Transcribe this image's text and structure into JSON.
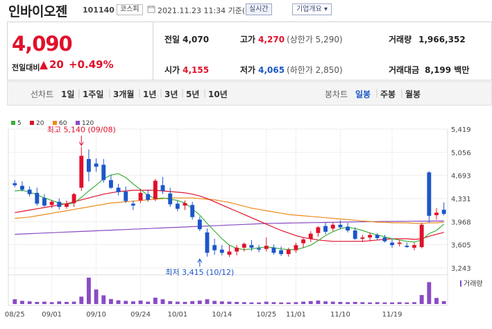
{
  "header": {
    "name": "인바이오젠",
    "code": "101140",
    "market": "코스피",
    "datetime": "2021.11.23 11:34 기준(장중)",
    "realtime_button": "실시간",
    "company_button": "기업개요 ▾"
  },
  "quote": {
    "price": "4,090",
    "diff_label": "전일대비",
    "diff_value": "20",
    "diff_rate": "+0.49%",
    "prev_close_label": "전일",
    "prev_close": "4,070",
    "high_label": "고가",
    "high": "4,270",
    "upper_limit": "(상한가 5,290)",
    "volume_label": "거래량",
    "volume": "1,966,352",
    "open_label": "시가",
    "open": "4,155",
    "low_label": "저가",
    "low": "4,065",
    "lower_limit": "(하한가 2,850)",
    "amount_label": "거래대금",
    "amount": "8,199 백만"
  },
  "tabs": {
    "line_label": "선차트",
    "line_periods": [
      "1일",
      "1주일",
      "3개월",
      "1년",
      "3년",
      "5년",
      "10년"
    ],
    "candle_label": "봉차트",
    "candle_periods": [
      "일봉",
      "주봉",
      "월봉"
    ],
    "active_candle": "일봉"
  },
  "colors": {
    "up": "#e0112b",
    "down": "#1c56c9",
    "ma5": "#3bb03b",
    "ma20": "#e0112b",
    "ma60": "#ef8a1a",
    "ma120": "#8a4bc4",
    "volume": "#8a4bc4"
  },
  "chart_data": {
    "type": "candlestick",
    "legend": [
      "5",
      "20",
      "60",
      "120"
    ],
    "y_ticks": [
      "5,419",
      "5,056",
      "4,693",
      "4,331",
      "3,968",
      "3,605",
      "3,243"
    ],
    "ylim": [
      3243,
      5419
    ],
    "x_labels": [
      "08/25",
      "09/01",
      "09/10",
      "09/24",
      "10/01",
      "10/14",
      "10/25",
      "11/01",
      "11/10",
      "11/19"
    ],
    "x_label_index": [
      0,
      5,
      11,
      17,
      22,
      28,
      34,
      38,
      44,
      51
    ],
    "high_annotation": "최고 5,140 (09/08)",
    "high_index": 9,
    "high_value": 5140,
    "low_annotation": "최저 3,415 (10/12)",
    "low_index": 25,
    "low_value": 3415,
    "volume_label": "거래량",
    "candles": [
      {
        "o": 4570,
        "h": 4620,
        "l": 4510,
        "c": 4540
      },
      {
        "o": 4530,
        "h": 4600,
        "l": 4440,
        "c": 4470
      },
      {
        "o": 4470,
        "h": 4520,
        "l": 4360,
        "c": 4400
      },
      {
        "o": 4420,
        "h": 4500,
        "l": 4220,
        "c": 4250
      },
      {
        "o": 4340,
        "h": 4400,
        "l": 4200,
        "c": 4220
      },
      {
        "o": 4230,
        "h": 4310,
        "l": 4180,
        "c": 4280
      },
      {
        "o": 4280,
        "h": 4330,
        "l": 4160,
        "c": 4200
      },
      {
        "o": 4200,
        "h": 4300,
        "l": 4170,
        "c": 4250
      },
      {
        "o": 4260,
        "h": 4420,
        "l": 4200,
        "c": 4400
      },
      {
        "o": 4500,
        "h": 5140,
        "l": 4450,
        "c": 5000
      },
      {
        "o": 4950,
        "h": 5100,
        "l": 4600,
        "c": 4750
      },
      {
        "o": 4880,
        "h": 4960,
        "l": 4750,
        "c": 4830
      },
      {
        "o": 4860,
        "h": 4950,
        "l": 4580,
        "c": 4620
      },
      {
        "o": 4620,
        "h": 4700,
        "l": 4480,
        "c": 4500
      },
      {
        "o": 4500,
        "h": 4560,
        "l": 4380,
        "c": 4430
      },
      {
        "o": 4440,
        "h": 4520,
        "l": 4260,
        "c": 4290
      },
      {
        "o": 4250,
        "h": 4300,
        "l": 4150,
        "c": 4220
      },
      {
        "o": 4300,
        "h": 4480,
        "l": 4260,
        "c": 4420
      },
      {
        "o": 4400,
        "h": 4470,
        "l": 4280,
        "c": 4310
      },
      {
        "o": 4320,
        "h": 4640,
        "l": 4290,
        "c": 4610
      },
      {
        "o": 4540,
        "h": 4670,
        "l": 4400,
        "c": 4450
      },
      {
        "o": 4410,
        "h": 4500,
        "l": 4200,
        "c": 4240
      },
      {
        "o": 4250,
        "h": 4300,
        "l": 4130,
        "c": 4170
      },
      {
        "o": 4220,
        "h": 4300,
        "l": 4150,
        "c": 4260
      },
      {
        "o": 4230,
        "h": 4280,
        "l": 4000,
        "c": 4040
      },
      {
        "o": 4000,
        "h": 4050,
        "l": 3820,
        "c": 3850
      },
      {
        "o": 3800,
        "h": 3860,
        "l": 3420,
        "c": 3480
      },
      {
        "o": 3600,
        "h": 3700,
        "l": 3450,
        "c": 3520
      },
      {
        "o": 3530,
        "h": 3600,
        "l": 3440,
        "c": 3480
      },
      {
        "o": 3450,
        "h": 3600,
        "l": 3415,
        "c": 3500
      },
      {
        "o": 3500,
        "h": 3600,
        "l": 3440,
        "c": 3560
      },
      {
        "o": 3560,
        "h": 3640,
        "l": 3500,
        "c": 3620
      },
      {
        "o": 3600,
        "h": 3680,
        "l": 3510,
        "c": 3560
      },
      {
        "o": 3550,
        "h": 3600,
        "l": 3490,
        "c": 3530
      },
      {
        "o": 3540,
        "h": 3720,
        "l": 3500,
        "c": 3590
      },
      {
        "o": 3560,
        "h": 3610,
        "l": 3450,
        "c": 3480
      },
      {
        "o": 3520,
        "h": 3580,
        "l": 3430,
        "c": 3460
      },
      {
        "o": 3460,
        "h": 3560,
        "l": 3420,
        "c": 3530
      },
      {
        "o": 3520,
        "h": 3640,
        "l": 3480,
        "c": 3600
      },
      {
        "o": 3630,
        "h": 3720,
        "l": 3560,
        "c": 3690
      },
      {
        "o": 3700,
        "h": 3820,
        "l": 3650,
        "c": 3780
      },
      {
        "o": 3790,
        "h": 3900,
        "l": 3730,
        "c": 3880
      },
      {
        "o": 3900,
        "h": 3950,
        "l": 3770,
        "c": 3810
      },
      {
        "o": 3860,
        "h": 3960,
        "l": 3820,
        "c": 3920
      },
      {
        "o": 3920,
        "h": 3990,
        "l": 3850,
        "c": 3880
      },
      {
        "o": 3890,
        "h": 3950,
        "l": 3800,
        "c": 3830
      },
      {
        "o": 3830,
        "h": 3880,
        "l": 3680,
        "c": 3700
      },
      {
        "o": 3700,
        "h": 3760,
        "l": 3650,
        "c": 3720
      },
      {
        "o": 3720,
        "h": 3800,
        "l": 3660,
        "c": 3760
      },
      {
        "o": 3760,
        "h": 3790,
        "l": 3680,
        "c": 3710
      },
      {
        "o": 3720,
        "h": 3760,
        "l": 3640,
        "c": 3660
      },
      {
        "o": 3640,
        "h": 3700,
        "l": 3560,
        "c": 3600
      },
      {
        "o": 3620,
        "h": 3680,
        "l": 3580,
        "c": 3640
      },
      {
        "o": 3590,
        "h": 3640,
        "l": 3560,
        "c": 3570
      },
      {
        "o": 3560,
        "h": 3640,
        "l": 3520,
        "c": 3600
      },
      {
        "o": 3570,
        "h": 3950,
        "l": 3550,
        "c": 3920
      },
      {
        "o": 4740,
        "h": 4760,
        "l": 3950,
        "c": 4060
      },
      {
        "o": 4070,
        "h": 4180,
        "l": 4000,
        "c": 4110
      },
      {
        "o": 4155,
        "h": 4270,
        "l": 4065,
        "c": 4090
      }
    ],
    "volumes": [
      0.18,
      0.12,
      0.1,
      0.08,
      0.09,
      0.07,
      0.1,
      0.08,
      0.09,
      0.28,
      1.0,
      0.55,
      0.33,
      0.19,
      0.14,
      0.12,
      0.1,
      0.13,
      0.09,
      0.24,
      0.18,
      0.11,
      0.09,
      0.08,
      0.11,
      0.13,
      0.18,
      0.12,
      0.1,
      0.09,
      0.08,
      0.07,
      0.06,
      0.06,
      0.09,
      0.07,
      0.06,
      0.06,
      0.07,
      0.09,
      0.11,
      0.13,
      0.1,
      0.09,
      0.08,
      0.07,
      0.08,
      0.07,
      0.06,
      0.07,
      0.06,
      0.06,
      0.07,
      0.06,
      0.07,
      0.34,
      0.83,
      0.23,
      0.11
    ],
    "ma5": [
      4450,
      4460,
      4430,
      4390,
      4340,
      4300,
      4260,
      4240,
      4260,
      4350,
      4450,
      4540,
      4640,
      4700,
      4720,
      4660,
      4560,
      4470,
      4380,
      4330,
      4340,
      4320,
      4300,
      4260,
      4170,
      4070,
      3940,
      3820,
      3700,
      3600,
      3550,
      3530,
      3540,
      3560,
      3570,
      3560,
      3540,
      3530,
      3530,
      3560,
      3600,
      3670,
      3750,
      3810,
      3860,
      3880,
      3860,
      3830,
      3790,
      3760,
      3730,
      3700,
      3680,
      3660,
      3650,
      3680,
      3780,
      3830,
      3930
    ],
    "ma20": [
      4110,
      4130,
      4150,
      4170,
      4190,
      4210,
      4230,
      4250,
      4280,
      4310,
      4340,
      4370,
      4400,
      4420,
      4440,
      4450,
      4460,
      4460,
      4460,
      4460,
      4450,
      4440,
      4430,
      4420,
      4400,
      4370,
      4330,
      4280,
      4230,
      4180,
      4130,
      4080,
      4030,
      3980,
      3930,
      3880,
      3830,
      3790,
      3750,
      3720,
      3700,
      3680,
      3670,
      3660,
      3660,
      3660,
      3660,
      3660,
      3670,
      3680,
      3690,
      3700,
      3700,
      3700,
      3690,
      3700,
      3740,
      3770,
      3800
    ],
    "ma60": [
      4020,
      4030,
      4040,
      4060,
      4080,
      4100,
      4120,
      4140,
      4160,
      4180,
      4200,
      4220,
      4240,
      4260,
      4270,
      4280,
      4290,
      4300,
      4310,
      4320,
      4330,
      4340,
      4340,
      4340,
      4340,
      4330,
      4320,
      4310,
      4290,
      4270,
      4240,
      4210,
      4180,
      4160,
      4140,
      4120,
      4100,
      4080,
      4070,
      4060,
      4050,
      4040,
      4030,
      4020,
      4010,
      4000,
      3990,
      3980,
      3970,
      3960,
      3960,
      3950,
      3950,
      3950,
      3940,
      3940,
      3950,
      3950,
      3960
    ],
    "ma120": [
      3770,
      3775,
      3780,
      3785,
      3790,
      3795,
      3800,
      3805,
      3810,
      3815,
      3820,
      3825,
      3830,
      3835,
      3840,
      3845,
      3850,
      3855,
      3860,
      3865,
      3870,
      3875,
      3880,
      3885,
      3890,
      3895,
      3900,
      3905,
      3910,
      3915,
      3920,
      3925,
      3930,
      3935,
      3940,
      3942,
      3944,
      3946,
      3948,
      3950,
      3952,
      3954,
      3956,
      3958,
      3960,
      3962,
      3964,
      3966,
      3968,
      3970,
      3971,
      3972,
      3973,
      3974,
      3975,
      3976,
      3977,
      3978,
      3979
    ]
  }
}
